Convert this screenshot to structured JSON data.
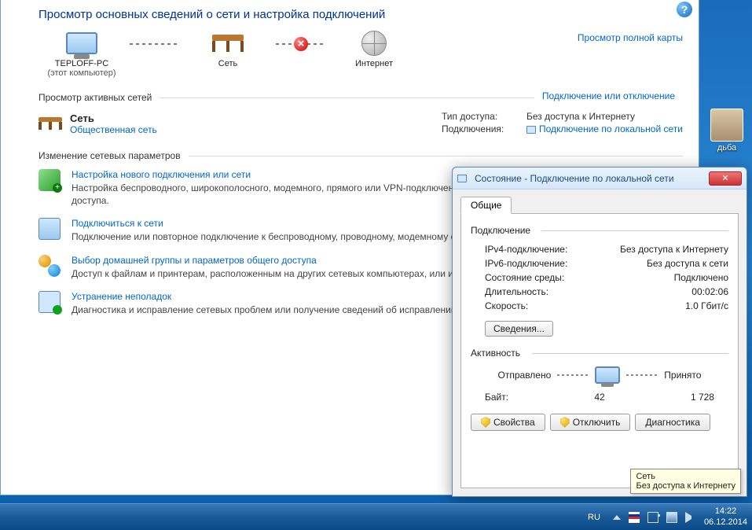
{
  "main": {
    "title": "Просмотр основных сведений о сети и настройка подключений",
    "nodes": {
      "pc_name": "TEPLOFF-PC",
      "pc_sub": "(этот компьютер)",
      "network": "Сеть",
      "internet": "Интернет"
    },
    "view_full_map": "Просмотр полной карты",
    "active_nets_label": "Просмотр активных сетей",
    "connect_disconnect": "Подключение или отключение",
    "active": {
      "name": "Сеть",
      "type": "Общественная сеть",
      "access_label": "Тип доступа:",
      "access_value": "Без доступа к Интернету",
      "conn_label": "Подключения:",
      "conn_value": "Подключение по локальной сети"
    },
    "change_settings_label": "Изменение сетевых параметров",
    "tasks": [
      {
        "title": "Настройка нового подключения или сети",
        "desc": "Настройка беспроводного, широкополосного, модемного, прямого или VPN-подключения или же настройка маршрутизатора или точки доступа."
      },
      {
        "title": "Подключиться к сети",
        "desc": "Подключение или повторное подключение к беспроводному, проводному, модемному сетевому соединению или подключение к VPN."
      },
      {
        "title": "Выбор домашней группы и параметров общего доступа",
        "desc": "Доступ к файлам и принтерам, расположенным на других сетевых компьютерах, или изменение параметров общего доступа."
      },
      {
        "title": "Устранение неполадок",
        "desc": "Диагностика и исправление сетевых проблем или получение сведений об исправлении."
      }
    ]
  },
  "dialog": {
    "title": "Состояние - Подключение по локальной сети",
    "tab": "Общие",
    "conn_section": "Подключение",
    "rows": {
      "ipv4_k": "IPv4-подключение:",
      "ipv4_v": "Без доступа к Интернету",
      "ipv6_k": "IPv6-подключение:",
      "ipv6_v": "Без доступа к сети",
      "media_k": "Состояние среды:",
      "media_v": "Подключено",
      "dur_k": "Длительность:",
      "dur_v": "00:02:06",
      "speed_k": "Скорость:",
      "speed_v": "1.0 Гбит/с"
    },
    "details_btn": "Сведения...",
    "activity_section": "Активность",
    "sent_label": "Отправлено",
    "recv_label": "Принято",
    "bytes_label": "Байт:",
    "bytes_sent": "42",
    "bytes_recv": "1 728",
    "btn_props": "Свойства",
    "btn_disable": "Отключить",
    "btn_diag": "Диагностика"
  },
  "tooltip": {
    "line1": "Сеть",
    "line2": "Без доступа к Интернету"
  },
  "taskbar": {
    "lang": "RU",
    "time": "14:22",
    "date": "06.12.2014"
  },
  "desktop_icon_label": "дьба"
}
